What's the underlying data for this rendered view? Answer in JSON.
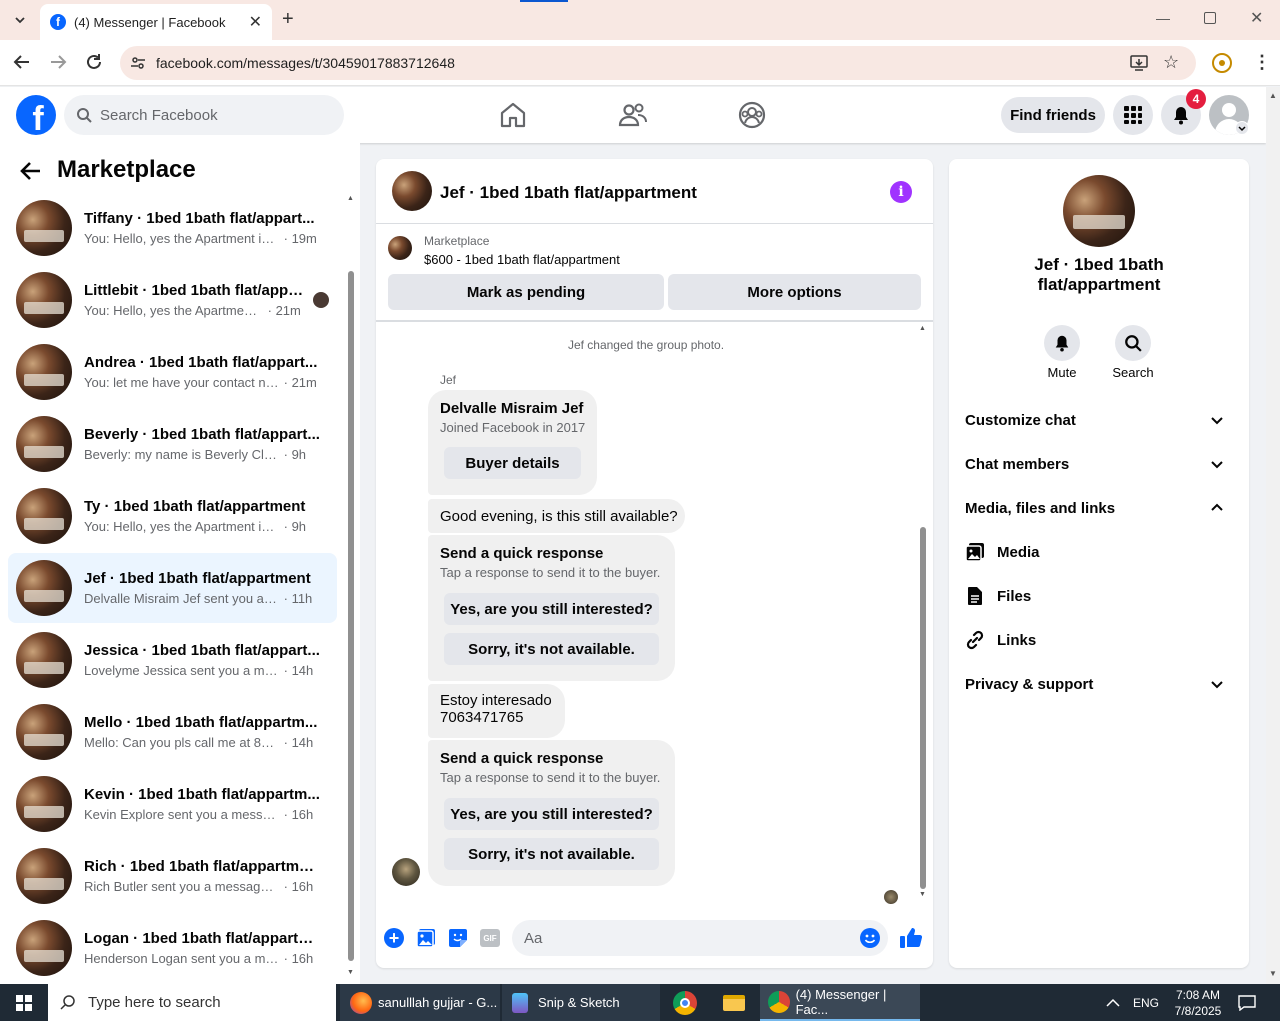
{
  "browser": {
    "tab_title": "(4) Messenger | Facebook",
    "url": "facebook.com/messages/t/30459017883712648"
  },
  "header": {
    "search_placeholder": "Search Facebook",
    "find_friends": "Find friends",
    "notification_count": "4"
  },
  "sidebar": {
    "title": "Marketplace",
    "conversations": [
      {
        "title": "Tiffany · 1bed 1bath flat/appart...",
        "snippet": "You: Hello, yes the Apartment is s...",
        "time": "19m"
      },
      {
        "title": "Littlebit · 1bed 1bath flat/appa...",
        "snippet": "You: Hello, yes the Apartment i...",
        "time": "21m"
      },
      {
        "title": "Andrea · 1bed 1bath flat/appart...",
        "snippet": "You: let me have your contact nu...",
        "time": "21m"
      },
      {
        "title": "Beverly · 1bed 1bath flat/appart...",
        "snippet": "Beverly: my name is Beverly Claibor...",
        "time": "9h"
      },
      {
        "title": "Ty · 1bed 1bath flat/appartment",
        "snippet": "You: Hello, yes the Apartment is stil...",
        "time": "9h"
      },
      {
        "title": "Jef · 1bed 1bath flat/appartment",
        "snippet": "Delvalle Misraim Jef sent you a m...",
        "time": "11h"
      },
      {
        "title": "Jessica · 1bed 1bath flat/appart...",
        "snippet": "Lovelyme Jessica sent you a mess...",
        "time": "14h"
      },
      {
        "title": "Mello · 1bed 1bath flat/appartm...",
        "snippet": "Mello: Can you pls call me at 804-...",
        "time": "14h"
      },
      {
        "title": "Kevin · 1bed 1bath flat/appartm...",
        "snippet": "Kevin Explore sent you a message ...",
        "time": "16h"
      },
      {
        "title": "Rich · 1bed 1bath flat/appartment",
        "snippet": "Rich Butler sent you a message ab...",
        "time": "16h"
      },
      {
        "title": "Logan · 1bed 1bath flat/appartm...",
        "snippet": "Henderson Logan sent you a mes...",
        "time": "16h"
      }
    ]
  },
  "chat": {
    "title": "Jef · 1bed 1bath flat/appartment",
    "listing_source": "Marketplace",
    "listing": "$600 - 1bed 1bath flat/appartment",
    "mark_pending": "Mark as pending",
    "more_options": "More options",
    "system_msg": "Jef changed the group photo.",
    "sender_name": "Jef",
    "buyer_name": "Delvalle Misraim Jef",
    "buyer_joined": "Joined Facebook in 2017",
    "buyer_details": "Buyer details",
    "msg1": "Good evening, is this still available?",
    "quick_title": "Send a quick response",
    "quick_sub": "Tap a response to send it to the buyer.",
    "quick_yes": "Yes, are you still interested?",
    "quick_no": "Sorry, it's not available.",
    "msg2_line1": "Estoy interesado",
    "msg2_line2": "7063471765",
    "composer_placeholder": "Aa"
  },
  "details": {
    "name": "Jef · 1bed 1bath flat/appartment",
    "mute": "Mute",
    "search": "Search",
    "customize": "Customize chat",
    "members": "Chat members",
    "media_section": "Media, files and links",
    "media": "Media",
    "files": "Files",
    "links": "Links",
    "privacy": "Privacy & support"
  },
  "taskbar": {
    "search_placeholder": "Type here to search",
    "app_firefox": "sanulllah gujjar - G...",
    "app_snip": "Snip & Sketch",
    "app_messenger": "(4) Messenger | Fac...",
    "lang": "ENG",
    "time": "7:08 AM",
    "date": "7/8/2025"
  },
  "colors": {
    "fb_blue": "#0866ff",
    "active_conv": "#ebf5ff",
    "badge_red": "#e41e3f",
    "info_purple": "#a033ff"
  }
}
